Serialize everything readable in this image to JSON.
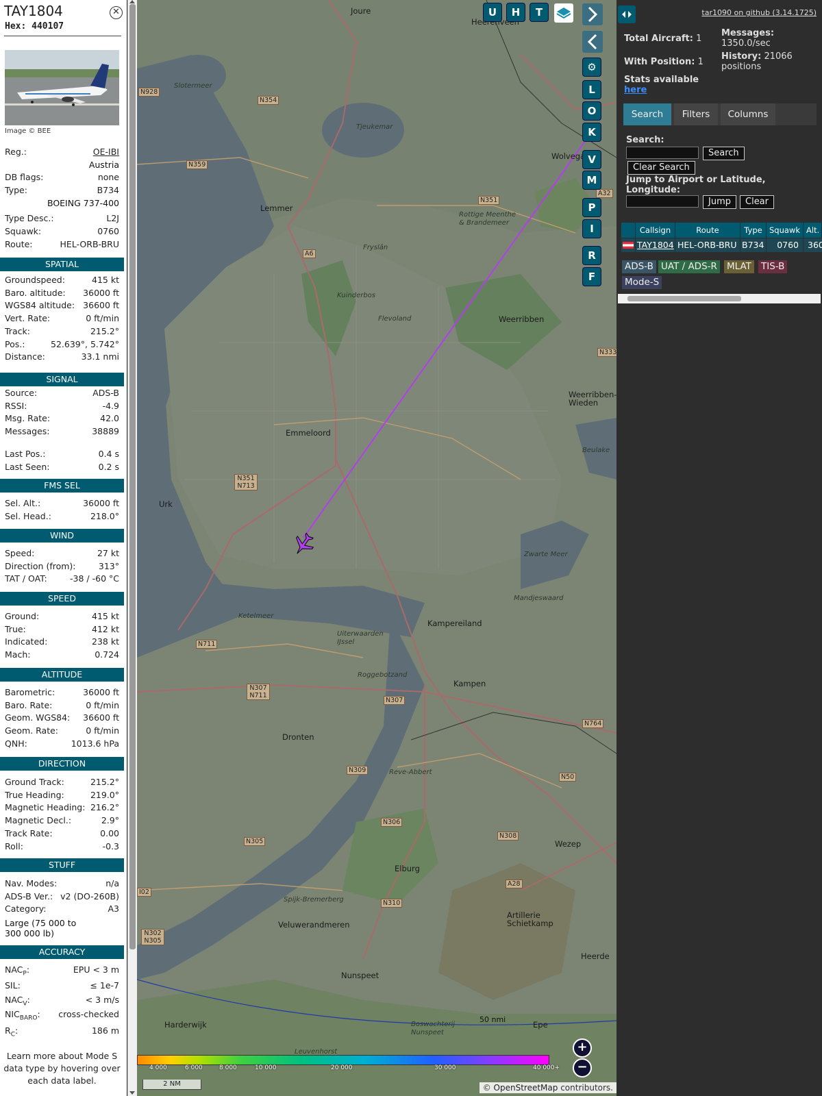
{
  "info": {
    "callsign": "TAY1804",
    "hex_label": "Hex: 440107",
    "close_glyph": "✕",
    "image_credit": "Image © BEE",
    "reg_label": "Reg.:",
    "reg": "OE-IBI",
    "country": "Austria",
    "dbflags_label": "DB flags:",
    "dbflags": "none",
    "type_label": "Type:",
    "type": "B734",
    "type_full": "BOEING 737-400",
    "typedesc_label": "Type Desc.:",
    "typedesc": "L2J",
    "squawk_label": "Squawk:",
    "squawk": "0760",
    "route_label": "Route:",
    "route": "HEL-ORB-BRU",
    "sections": {
      "spatial": "SPATIAL",
      "signal": "SIGNAL",
      "fms": "FMS SEL",
      "wind": "WIND",
      "speed": "SPEED",
      "altitude": "ALTITUDE",
      "direction": "DIRECTION",
      "stuff": "STUFF",
      "accuracy": "ACCURACY"
    },
    "spatial": [
      {
        "label": "Groundspeed:",
        "value": "415 kt"
      },
      {
        "label": "Baro. altitude:",
        "value": "36000 ft"
      },
      {
        "label": "WGS84 altitude:",
        "value": "36600 ft"
      },
      {
        "label": "Vert. Rate:",
        "value": "0 ft/min"
      },
      {
        "label": "Track:",
        "value": "215.2°"
      },
      {
        "label": "Pos.:",
        "value": "52.639°, 5.742°"
      },
      {
        "label": "Distance:",
        "value": "33.1 nmi"
      }
    ],
    "signal": [
      {
        "label": "Source:",
        "value": "ADS-B"
      },
      {
        "label": "RSSI:",
        "value": "-4.9"
      },
      {
        "label": "Msg. Rate:",
        "value": "42.0"
      },
      {
        "label": "Messages:",
        "value": "38889"
      },
      {
        "label": "Last Pos.:",
        "value": "0.4 s"
      },
      {
        "label": "Last Seen:",
        "value": "0.2 s"
      }
    ],
    "fms": [
      {
        "label": "Sel. Alt.:",
        "value": "36000 ft"
      },
      {
        "label": "Sel. Head.:",
        "value": "218.0°"
      }
    ],
    "wind": [
      {
        "label": "Speed:",
        "value": "27 kt"
      },
      {
        "label": "Direction (from):",
        "value": "313°"
      },
      {
        "label": "TAT / OAT:",
        "value": "-38 / -60 °C"
      }
    ],
    "speed": [
      {
        "label": "Ground:",
        "value": "415 kt"
      },
      {
        "label": "True:",
        "value": "412 kt"
      },
      {
        "label": "Indicated:",
        "value": "238 kt"
      },
      {
        "label": "Mach:",
        "value": "0.724"
      }
    ],
    "altitude": [
      {
        "label": "Barometric:",
        "value": "36000 ft"
      },
      {
        "label": "Baro. Rate:",
        "value": "0 ft/min"
      },
      {
        "label": "Geom. WGS84:",
        "value": "36600 ft"
      },
      {
        "label": "Geom. Rate:",
        "value": "0 ft/min"
      },
      {
        "label": "QNH:",
        "value": "1013.6 hPa"
      }
    ],
    "direction": [
      {
        "label": "Ground Track:",
        "value": "215.2°"
      },
      {
        "label": "True Heading:",
        "value": "219.0°"
      },
      {
        "label": "Magnetic Heading:",
        "value": "216.2°"
      },
      {
        "label": "Magnetic Decl.:",
        "value": "2.9°"
      },
      {
        "label": "Track Rate:",
        "value": "0.00"
      },
      {
        "label": "Roll:",
        "value": "-0.3"
      }
    ],
    "stuff": [
      {
        "label": "Nav. Modes:",
        "value": "n/a"
      },
      {
        "label": "ADS-B Ver.:",
        "value": "v2 (DO-260B)"
      },
      {
        "label": "Category:",
        "value": "A3"
      }
    ],
    "category_desc": "Large (75 000 to 300 000 lb)",
    "accuracy": [
      {
        "label": "NAC",
        "sub": "P",
        "rest": ":",
        "value": "EPU < 3 m"
      },
      {
        "label": "SIL:",
        "sub": "",
        "rest": "",
        "value": "≤ 1e-7"
      },
      {
        "label": "NAC",
        "sub": "V",
        "rest": ":",
        "value": "< 3 m/s"
      },
      {
        "label": "NIC",
        "sub": "BARO",
        "rest": ":",
        "value": "cross-checked"
      },
      {
        "label": "R",
        "sub": "C",
        "rest": ":",
        "value": "186 m"
      }
    ],
    "learn_more": "Learn more about Mode S data type by hovering over each data label."
  },
  "map": {
    "buttons_top": [
      "U",
      "H",
      "T"
    ],
    "side_buttons": [
      "L",
      "O",
      "K",
      "V",
      "M",
      "P",
      "I",
      "R",
      "F"
    ],
    "scale": "2 NM",
    "range_ring": "50 nmi",
    "attribution_prefix": "© ",
    "attribution_link": "OpenStreetMap",
    "attribution_suffix": " contributors.",
    "zoom_in": "+",
    "zoom_out": "−",
    "altitude_legend": [
      "4 000",
      "6 000",
      "8 000",
      "10 000",
      "20 000",
      "30 000",
      "40 000+"
    ],
    "place_labels": [
      "Joure",
      "Heerenveen",
      "Wolvega",
      "Lemmer",
      "Emmeloord",
      "Urk",
      "Kuinderbos",
      "Weerribben",
      "Weerribben-Wieden",
      "Zwarte Meer",
      "Mandjeswaard",
      "Kampereiland",
      "Ketelmeer",
      "Uiterwaarden IJssel",
      "Roggebotzand",
      "Kampen",
      "Dronten",
      "Reve-Abbert",
      "Elburg",
      "Wezep",
      "Artillerie Schietkamp",
      "Spijk-Bremerberg",
      "Veluwerandmeren",
      "Nunspeet",
      "Harderwijk",
      "Leuvenhorst",
      "Epe",
      "Heerde",
      "Slotermeer",
      "Tjeukemar",
      "Rottige Meenthe & Brandemeer",
      "Flevoland",
      "Fryslân",
      "Beulake",
      "Boswachterij Nunspeet"
    ],
    "road_labels": [
      "N928",
      "N354",
      "N359",
      "N351",
      "A6",
      "N351 N713",
      "N711",
      "N307 N711",
      "N307",
      "N309",
      "N306",
      "N305",
      "N308",
      "N310",
      "A28",
      "N302 N305",
      "N764",
      "N50",
      "N333",
      "A32",
      "I02"
    ]
  },
  "right": {
    "github": "tar1090 on github (3.14.1725)",
    "total_label": "Total Aircraft:",
    "total": "1",
    "withpos_label": "With Position:",
    "withpos": "1",
    "stats_label": "Stats available",
    "stats_link": "here",
    "messages_label": "Messages:",
    "messages": "1350.0/sec",
    "history_label": "History:",
    "history": "21066 positions",
    "tabs": [
      "Search",
      "Filters",
      "Columns"
    ],
    "search_label": "Search:",
    "search_btn": "Search",
    "clear_search": "Clear Search",
    "jump_label": "Jump to Airport or Latitude, Longitude:",
    "jump_btn": "Jump",
    "clear_btn": "Clear",
    "table": {
      "headers": [
        "Callsign",
        "Route",
        "Type",
        "Squawk",
        "Alt."
      ],
      "row": {
        "callsign": "TAY1804",
        "route": "HEL-ORB-BRU",
        "type": "B734",
        "squawk": "0760",
        "alt": "36000"
      }
    },
    "sources": [
      "ADS-B",
      "UAT / ADS-R",
      "MLAT",
      "TIS-B",
      "Mode-S"
    ]
  },
  "colors": {
    "accent": "#005a70",
    "track": "#b040e8",
    "adsb": "#3a5566",
    "uat": "#2f6b45",
    "mlat": "#6b6035",
    "tisb": "#6b2e40",
    "modes": "#3c4160"
  }
}
